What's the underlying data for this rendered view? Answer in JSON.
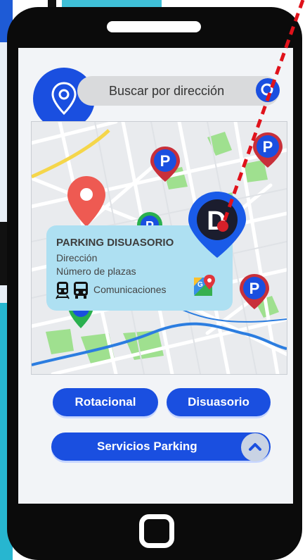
{
  "search": {
    "placeholder": "Buscar por dirección"
  },
  "popup": {
    "title": "PARKING DISUASORIO",
    "line1": "Dirección",
    "line2": "Número de plazas",
    "comms_label": "Comunicaciones"
  },
  "buttons": {
    "rotacional": "Rotacional",
    "disuasorio": "Disuasorio",
    "servicios": "Servicios Parking"
  },
  "markers": {
    "parking_letter": "P",
    "disuasorio_letter": "D"
  },
  "colors": {
    "accent": "#1a4fe0",
    "marker_red": "#e0353b",
    "marker_green": "#2ab04f",
    "popup_bg": "#aee0f2",
    "annotation_red": "#e0121b"
  }
}
